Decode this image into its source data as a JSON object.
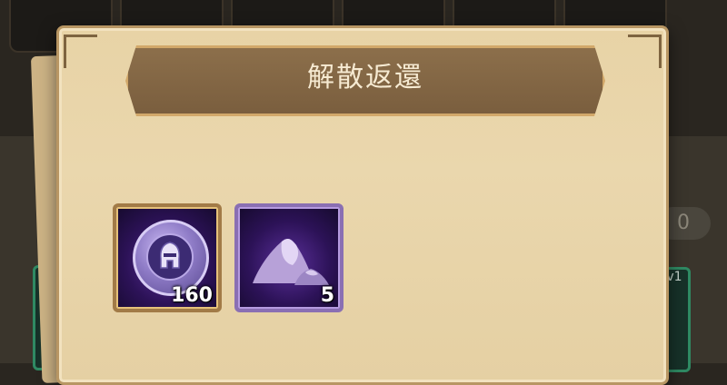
{
  "dialog": {
    "title": "解散返還"
  },
  "items": [
    {
      "name": "hero-token-coin",
      "icon": "helmet-coin-icon",
      "quantity": "160"
    },
    {
      "name": "purple-dust",
      "icon": "dust-pile-icon",
      "quantity": "5"
    }
  ],
  "background": {
    "pill_text": "0",
    "side_text": "v1"
  }
}
